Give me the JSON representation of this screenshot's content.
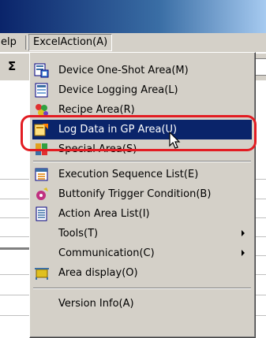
{
  "menubar": {
    "help_partial": "elp",
    "excel_action": "ExcelAction(A)"
  },
  "toolbar": {
    "sigma": "Σ"
  },
  "menu": {
    "items": [
      {
        "label": "Device One-Shot Area(M)",
        "icon": "device-one-shot-icon"
      },
      {
        "label": "Device Logging Area(L)",
        "icon": "device-logging-icon"
      },
      {
        "label": "Recipe Area(R)",
        "icon": "recipe-icon"
      },
      {
        "label": "Log Data in GP Area(U)",
        "icon": "log-data-icon",
        "highlighted": true
      },
      {
        "label": "Special Area(S)",
        "icon": "special-area-icon"
      },
      {
        "label": "Execution Sequence List(E)",
        "icon": "execution-sequence-icon"
      },
      {
        "label": "Buttonify Trigger Condition(B)",
        "icon": "buttonify-trigger-icon"
      },
      {
        "label": "Action Area List(I)",
        "icon": "action-area-list-icon"
      },
      {
        "label": "Tools(T)",
        "submenu": true
      },
      {
        "label": "Communication(C)",
        "submenu": true
      },
      {
        "label": "Area display(O)",
        "icon": "area-display-icon"
      },
      {
        "label": "Version Info(A)"
      }
    ]
  },
  "colors": {
    "highlight": "#0a246a",
    "menu_bg": "#d4d0c8",
    "annotation_ring": "#e21c22"
  }
}
